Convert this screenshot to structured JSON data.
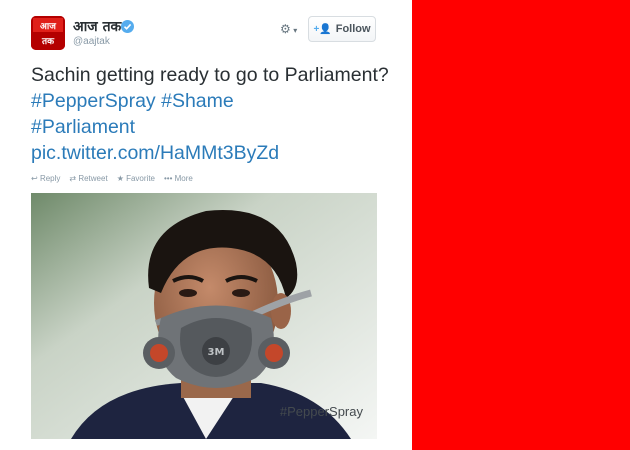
{
  "tweet": {
    "user_name": "आज तक",
    "handle": "@aajtak",
    "follow_label": "Follow",
    "text_plain": "Sachin getting ready to go to Parliament? ",
    "hashtag_1": "#PepperSpray",
    "hashtag_2": "#Shame",
    "hashtag_3": "#Parliament",
    "link": "pic.twitter.com/HaMMt3ByZd",
    "actions": {
      "reply": "Reply",
      "retweet": "Retweet",
      "favorite": "Favorite",
      "more": "More"
    },
    "photo_overlay": "#PepperSpray",
    "mask_brand": "3M"
  },
  "icons": {
    "verified": "verified-badge-icon",
    "gear": "gear-icon",
    "follow": "add-user-icon"
  },
  "colors": {
    "link": "#2b7bb9",
    "side_panel": "#ff0000",
    "verified": "#55acee"
  }
}
